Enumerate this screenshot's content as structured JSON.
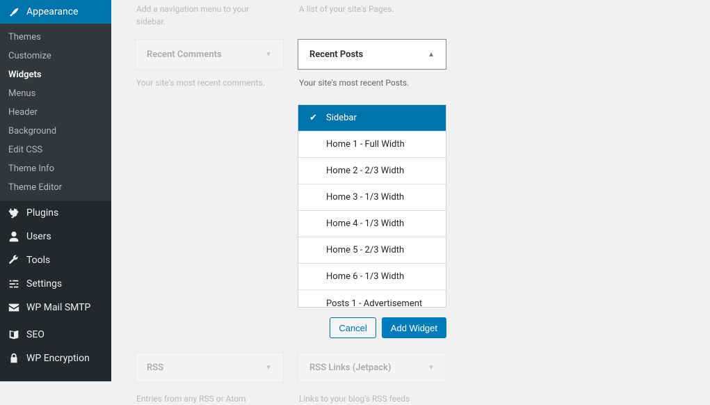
{
  "sidebar": {
    "appearance": "Appearance",
    "submenu": [
      "Themes",
      "Customize",
      "Widgets",
      "Menus",
      "Header",
      "Background",
      "Edit CSS",
      "Theme Info",
      "Theme Editor"
    ],
    "current_submenu": "Widgets",
    "items": [
      {
        "label": "Plugins",
        "icon": "plug"
      },
      {
        "label": "Users",
        "icon": "user"
      },
      {
        "label": "Tools",
        "icon": "wrench"
      },
      {
        "label": "Settings",
        "icon": "sliders"
      },
      {
        "label": "WP Mail SMTP",
        "icon": "mail"
      },
      {
        "label": "SEO",
        "icon": "seo"
      },
      {
        "label": "WP Encryption",
        "icon": "lock"
      }
    ]
  },
  "widgets": {
    "left_col": {
      "title": "Recent Comments",
      "above_desc": "Add a navigation menu to your sidebar.",
      "desc": "Your site's most recent comments."
    },
    "right_col": {
      "title": "Recent Posts",
      "above_desc": "A list of your site's Pages.",
      "desc": "Your site's most recent Posts."
    },
    "bottom_left": {
      "title": "RSS",
      "desc": "Entries from any RSS or Atom"
    },
    "bottom_right": {
      "title": "RSS Links (Jetpack)",
      "desc": "Links to your blog's RSS feeds"
    }
  },
  "areas": [
    {
      "label": "Sidebar",
      "selected": true
    },
    {
      "label": "Home 1 - Full Width"
    },
    {
      "label": "Home 2 - 2/3 Width"
    },
    {
      "label": "Home 3 - 1/3 Width"
    },
    {
      "label": "Home 4 - 1/3 Width"
    },
    {
      "label": "Home 5 - 2/3 Width"
    },
    {
      "label": "Home 6 - 1/3 Width"
    },
    {
      "label": "Posts 1 - Advertisement"
    }
  ],
  "buttons": {
    "cancel": "Cancel",
    "add": "Add Widget"
  }
}
